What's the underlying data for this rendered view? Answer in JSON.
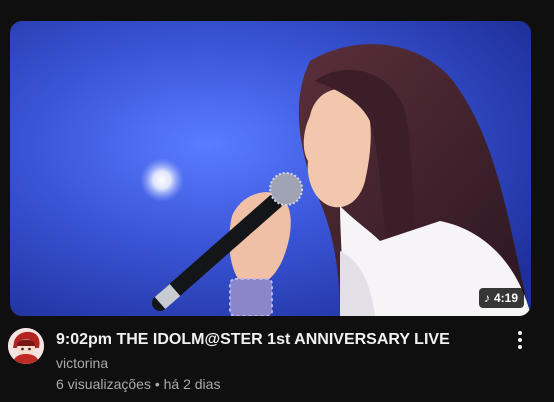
{
  "video": {
    "title": "9:02pm THE IDOLM@STER 1st ANNIVERSARY LIVE",
    "duration": "4:19",
    "duration_icon": "music-note-icon"
  },
  "channel": {
    "name": "victorina",
    "avatar_icon": "channel-avatar-icon"
  },
  "stats": {
    "views_date": "6 visualizações • há 2 dias"
  },
  "menu": {
    "icon": "more-vert-icon"
  },
  "colors": {
    "background": "#0f0f0f",
    "title_text": "#f1f1f1",
    "secondary_text": "#aaaaaa",
    "thumbnail_blue": "#3b55d6"
  }
}
